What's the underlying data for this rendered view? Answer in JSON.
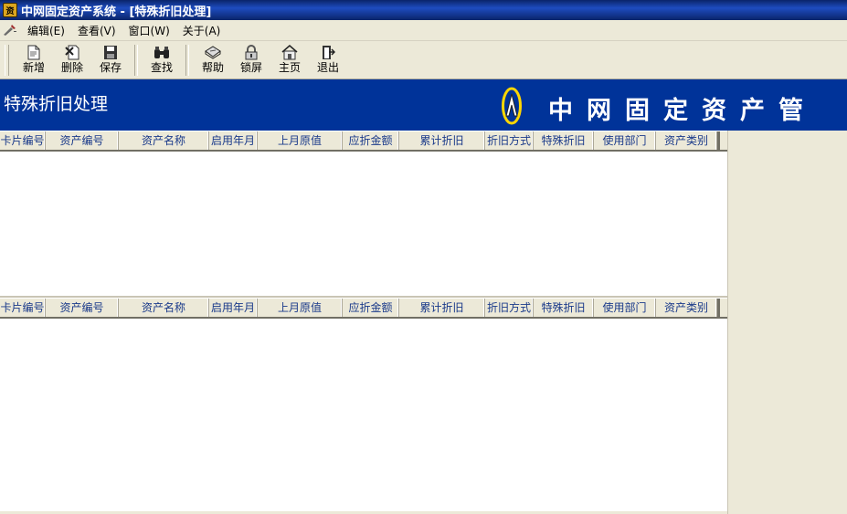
{
  "window": {
    "title": "中网固定资产系统 - [特殊折旧处理]",
    "icon": "app-icon"
  },
  "menu": {
    "items": [
      {
        "label": "编辑(E)"
      },
      {
        "label": "查看(V)"
      },
      {
        "label": "窗口(W)"
      },
      {
        "label": "关于(A)"
      }
    ]
  },
  "toolbar": {
    "buttons": [
      {
        "label": "新增",
        "icon": "new-doc-icon"
      },
      {
        "label": "删除",
        "icon": "delete-icon"
      },
      {
        "label": "保存",
        "icon": "save-icon"
      },
      {
        "label": "查找",
        "icon": "binoculars-icon"
      },
      {
        "label": "帮助",
        "icon": "help-book-icon"
      },
      {
        "label": "锁屏",
        "icon": "lock-icon"
      },
      {
        "label": "主页",
        "icon": "home-icon"
      },
      {
        "label": "退出",
        "icon": "exit-door-icon"
      }
    ]
  },
  "banner": {
    "title": "特殊折旧处理",
    "brand": "中网固定资产管理",
    "background": "#003399",
    "logo_color": "#ffd700"
  },
  "grid": {
    "columns": [
      "卡片编号",
      "资产编号",
      "资产名称",
      "启用年月",
      "上月原值",
      "应折金额",
      "累计折旧",
      "折旧方式",
      "特殊折旧",
      "使用部门",
      "资产类别"
    ],
    "header_text_color": "#1a3a8a"
  }
}
